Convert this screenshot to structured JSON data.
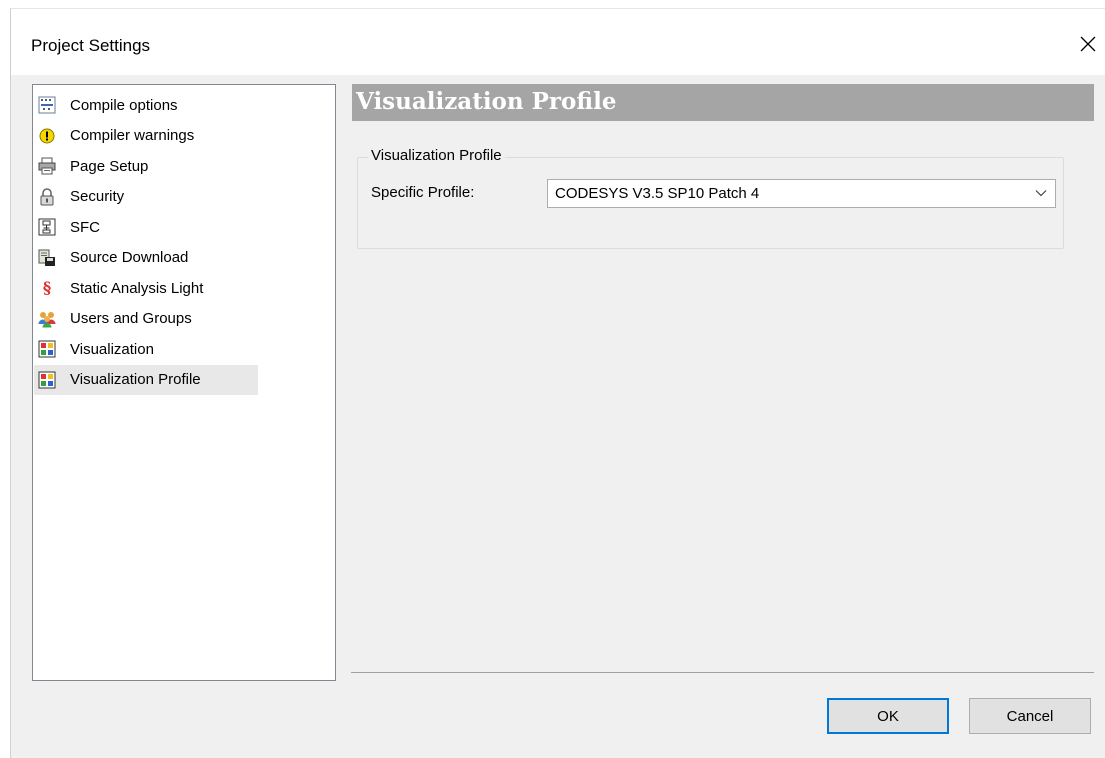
{
  "window": {
    "title": "Project Settings"
  },
  "tree": {
    "items": [
      {
        "label": "Compile options",
        "icon": "compile-options-icon"
      },
      {
        "label": "Compiler warnings",
        "icon": "warning-icon"
      },
      {
        "label": "Page Setup",
        "icon": "printer-icon"
      },
      {
        "label": "Security",
        "icon": "lock-icon"
      },
      {
        "label": "SFC",
        "icon": "sfc-icon"
      },
      {
        "label": "Source Download",
        "icon": "source-download-icon"
      },
      {
        "label": "Static Analysis Light",
        "icon": "section-sign-icon"
      },
      {
        "label": "Users and Groups",
        "icon": "users-icon"
      },
      {
        "label": "Visualization",
        "icon": "visualization-icon"
      },
      {
        "label": "Visualization Profile",
        "icon": "visualization-icon",
        "selected": true
      }
    ]
  },
  "panel": {
    "header": "Visualization Profile",
    "group_title": "Visualization Profile",
    "field_label": "Specific Profile:",
    "field_value": "CODESYS V3.5 SP10 Patch 4"
  },
  "buttons": {
    "ok": "OK",
    "cancel": "Cancel"
  },
  "colors": {
    "header_bg": "#a5a5a5",
    "default_button_border": "#0078d7",
    "selection_bg": "#e8e8e8"
  }
}
